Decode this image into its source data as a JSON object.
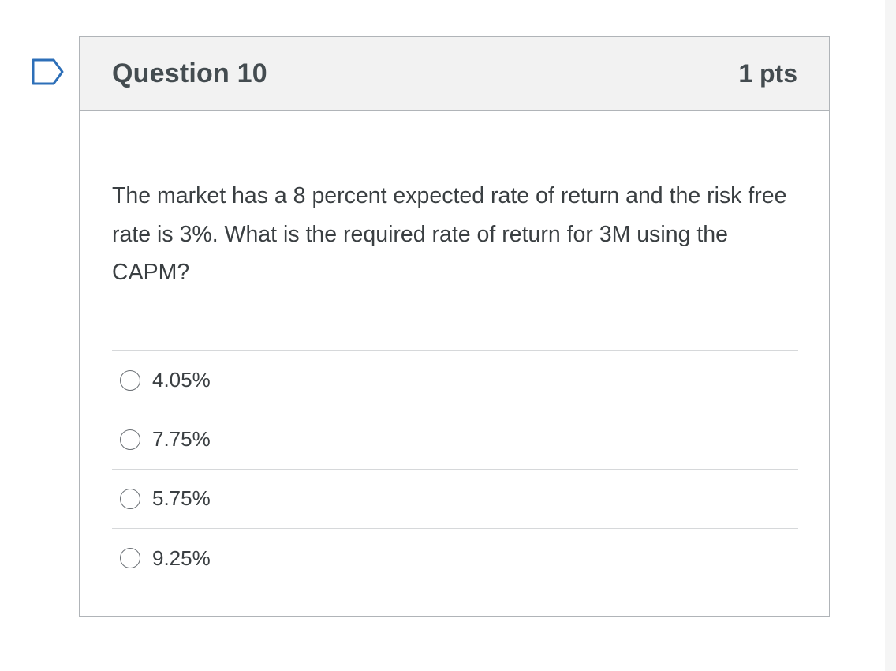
{
  "flag": {
    "icon": "bookmark-flag-icon",
    "color": "#2d6fb8"
  },
  "question": {
    "title": "Question 10",
    "points": "1 pts",
    "text": "The market has a 8 percent expected rate of return and the risk free rate is 3%. What is the required rate of return for 3M using the CAPM?",
    "answers": [
      {
        "label": "4.05%"
      },
      {
        "label": "7.75%"
      },
      {
        "label": "5.75%"
      },
      {
        "label": "9.25%"
      }
    ]
  }
}
